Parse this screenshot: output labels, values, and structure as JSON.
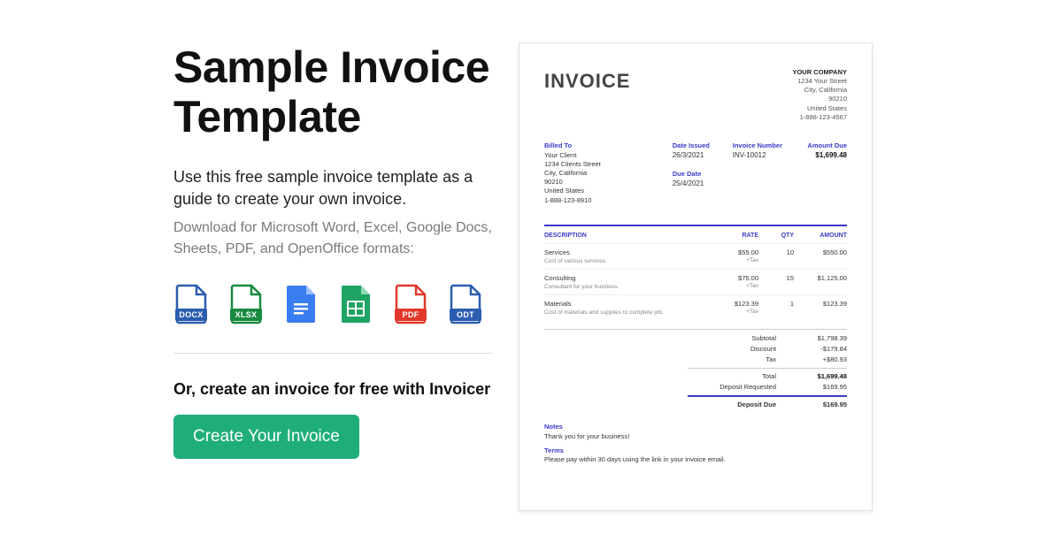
{
  "title": "Sample Invoice Template",
  "lead": "Use this free sample invoice template as a guide to create your own invoice.",
  "sub": "Download for Microsoft Word, Excel, Google Docs, Sheets, PDF, and OpenOffice formats:",
  "formats": {
    "docx": "DOCX",
    "xlsx": "XLSX",
    "pdf": "PDF",
    "odt": "ODT"
  },
  "or_line": "Or, create an invoice for free with Invoicer",
  "cta": "Create Your Invoice",
  "invoice": {
    "heading": "INVOICE",
    "company": {
      "name": "YOUR COMPANY",
      "street": "1234 Your Street",
      "city": "City, California",
      "zip": "90210",
      "country": "United States",
      "phone": "1-888-123-4567"
    },
    "labels": {
      "billed_to": "Billed To",
      "date_issued": "Date Issued",
      "invoice_number": "Invoice Number",
      "amount_due": "Amount Due",
      "due_date": "Due Date",
      "description": "DESCRIPTION",
      "rate": "RATE",
      "qty": "QTY",
      "amount": "AMOUNT",
      "subtotal": "Subtotal",
      "discount": "Discount",
      "tax": "Tax",
      "total": "Total",
      "deposit_requested": "Deposit Requested",
      "deposit_due": "Deposit Due",
      "notes": "Notes",
      "terms": "Terms",
      "plus_tax": "+Tax"
    },
    "client": {
      "name": "Your Client",
      "street": "1234 Clients Street",
      "city": "City, California",
      "zip": "90210",
      "country": "United States",
      "phone": "1-888-123-8910"
    },
    "meta": {
      "date_issued": "26/3/2021",
      "invoice_number": "INV-10012",
      "amount_due": "$1,699.48",
      "due_date": "25/4/2021"
    },
    "lines": [
      {
        "title": "Services",
        "desc": "Cost of various services.",
        "rate": "$55.00",
        "qty": "10",
        "amount": "$550.00"
      },
      {
        "title": "Consulting",
        "desc": "Consultant for your business.",
        "rate": "$75.00",
        "qty": "15",
        "amount": "$1,125.00"
      },
      {
        "title": "Materials",
        "desc": "Cost of materials and supplies to complete job.",
        "rate": "$123.39",
        "qty": "1",
        "amount": "$123.39"
      }
    ],
    "totals": {
      "subtotal": "$1,798.39",
      "discount": "-$179.84",
      "tax": "+$80.93",
      "total": "$1,699.48",
      "deposit_requested": "$169.95",
      "deposit_due": "$169.95"
    },
    "notes_text": "Thank you for your business!",
    "terms_text": "Please pay within 30 days using the link in your invoice email."
  }
}
